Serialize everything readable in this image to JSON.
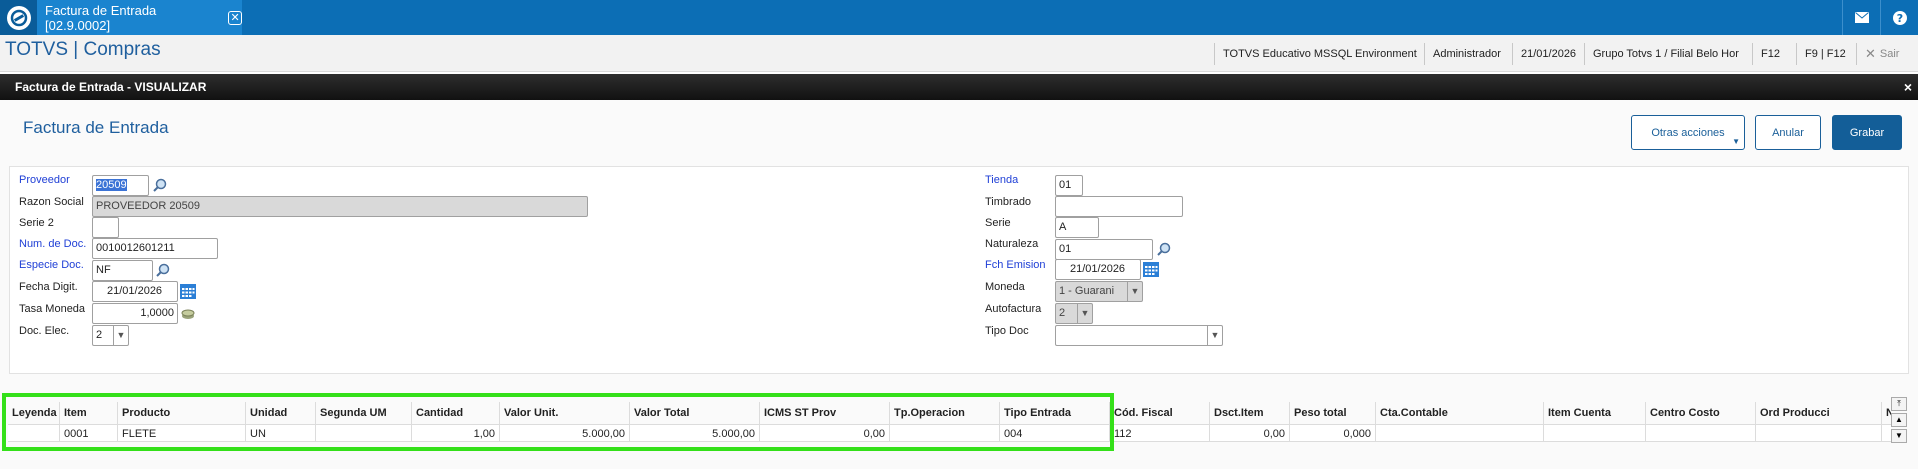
{
  "topbar": {
    "tab_title": "Factura de Entrada [02.9.0002]",
    "tab_close": "✕"
  },
  "appbar": {
    "title": "TOTVS | Compras",
    "environment": "TOTVS Educativo MSSQL Environment",
    "user": "Administrador",
    "date": "21/01/2026",
    "branch": "Grupo Totvs 1 / Filial Belo Hor",
    "f12": "F12",
    "f9": "F9 | F12",
    "exit": "Sair"
  },
  "dialog": {
    "title": "Factura de Entrada - VISUALIZAR",
    "close": "×"
  },
  "page": {
    "title": "Factura de Entrada",
    "btn_other": "Otras acciones",
    "btn_cancel": "Anular",
    "btn_save": "Grabar"
  },
  "form": {
    "proveedor_label": "Proveedor",
    "proveedor_value": "20509",
    "razon_label": "Razon Social",
    "razon_value": "PROVEEDOR 20509",
    "serie2_label": "Serie 2",
    "serie2_value": "",
    "numdoc_label": "Num. de Doc.",
    "numdoc_value": "0010012601211",
    "especie_label": "Especie Doc.",
    "especie_value": "NF",
    "fechadig_label": "Fecha Digit.",
    "fechadig_value": "21/01/2026",
    "tasa_label": "Tasa Moneda",
    "tasa_value": "1,0000",
    "docelec_label": "Doc. Elec.",
    "docelec_value": "2",
    "tienda_label": "Tienda",
    "tienda_value": "01",
    "timbrado_label": "Timbrado",
    "timbrado_value": "",
    "serie_label": "Serie",
    "serie_value": "A",
    "naturaleza_label": "Naturaleza",
    "naturaleza_value": "01",
    "fchemision_label": "Fch Emision",
    "fchemision_value": "21/01/2026",
    "moneda_label": "Moneda",
    "moneda_value": "1 - Guarani",
    "autofactura_label": "Autofactura",
    "autofactura_value": "2",
    "tipodoc_label": "Tipo Doc",
    "tipodoc_value": ""
  },
  "grid": {
    "headers": [
      "Leyenda",
      "Item",
      "Producto",
      "Unidad",
      "Segunda UM",
      "Cantidad",
      "Valor Unit.",
      "Valor Total",
      "ICMS ST Prov",
      "Tp.Operacion",
      "Tipo Entrada",
      "Cód. Fiscal",
      "Dsct.Item",
      "Peso total",
      "Cta.Contable",
      "Item Cuenta",
      "Centro Costo",
      "Ord Producci",
      "N"
    ],
    "row": [
      "",
      "0001",
      "FLETE",
      "UN",
      "",
      "1,00",
      "5.000,00",
      "5.000,00",
      "0,00",
      "",
      "004",
      "112",
      "0,00",
      "0,000",
      "",
      "",
      "",
      "",
      ""
    ]
  },
  "colors": {
    "topbar": "#0c6eb5",
    "title_blue": "#1f5f9e",
    "label_blue": "#1f3fd6",
    "highlight": "#34e019"
  }
}
